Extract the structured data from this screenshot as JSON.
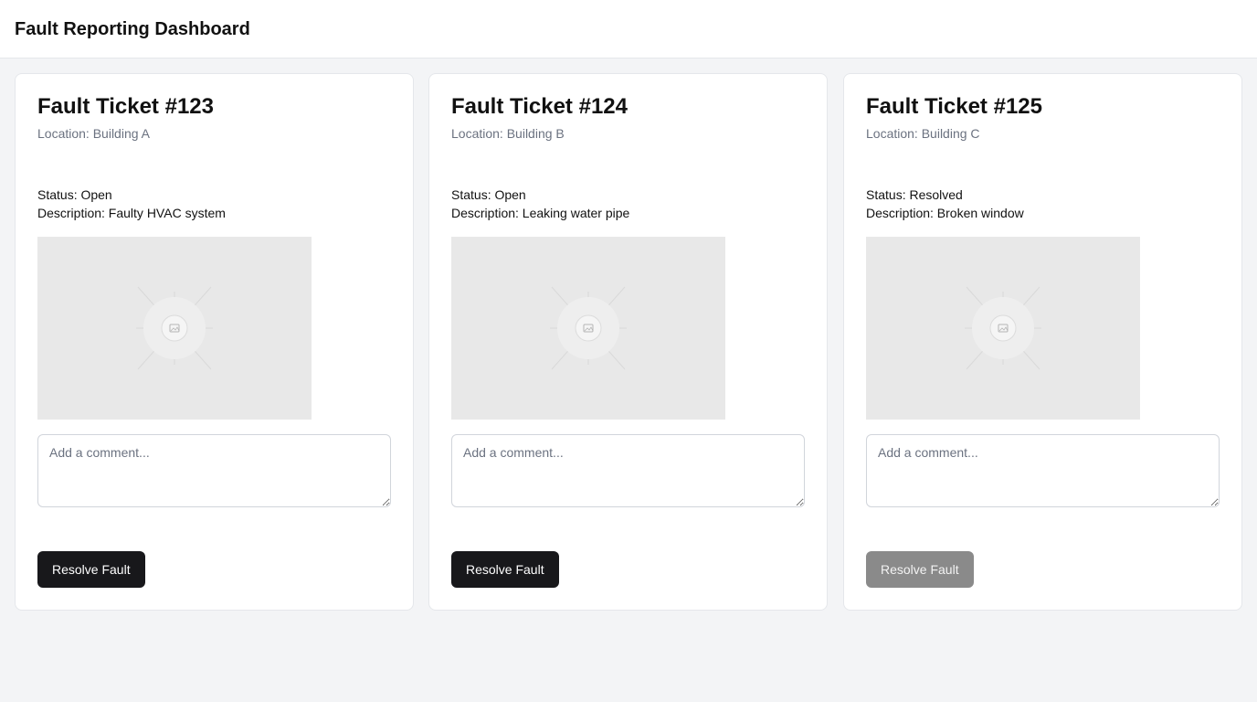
{
  "header": {
    "title": "Fault Reporting Dashboard"
  },
  "tickets": [
    {
      "title": "Fault Ticket #123",
      "location": "Location: Building A",
      "status": "Status: Open",
      "description": "Description: Faulty HVAC system",
      "comment_placeholder": "Add a comment...",
      "button_label": "Resolve Fault",
      "button_disabled": false
    },
    {
      "title": "Fault Ticket #124",
      "location": "Location: Building B",
      "status": "Status: Open",
      "description": "Description: Leaking water pipe",
      "comment_placeholder": "Add a comment...",
      "button_label": "Resolve Fault",
      "button_disabled": false
    },
    {
      "title": "Fault Ticket #125",
      "location": "Location: Building C",
      "status": "Status: Resolved",
      "description": "Description: Broken window",
      "comment_placeholder": "Add a comment...",
      "button_label": "Resolve Fault",
      "button_disabled": true
    }
  ],
  "colors": {
    "page_background": "#f3f4f6",
    "card_background": "#ffffff",
    "primary_button": "#18181b",
    "disabled_button": "#8a8a8a",
    "muted_text": "#6b7280"
  },
  "icons": {
    "image_placeholder": "image-placeholder-icon"
  }
}
